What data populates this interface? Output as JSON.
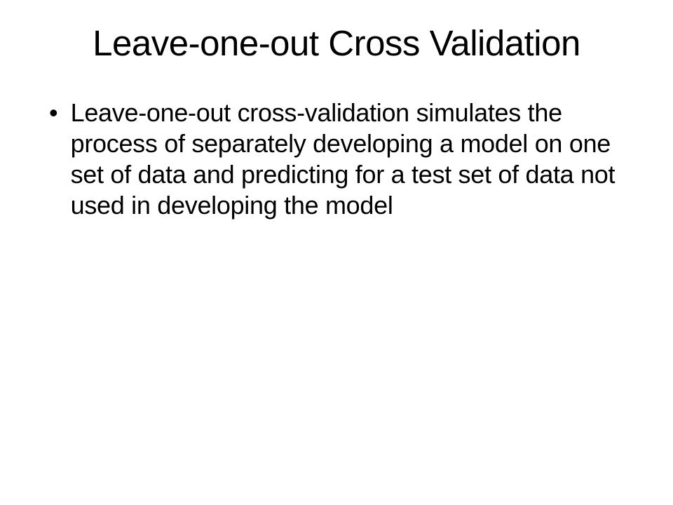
{
  "slide": {
    "title": "Leave-one-out Cross Validation",
    "bullets": [
      {
        "text": "Leave-one-out cross-validation simulates the process of separately developing a model on one set of data and predicting for a test set of data not used in developing the model"
      }
    ]
  }
}
